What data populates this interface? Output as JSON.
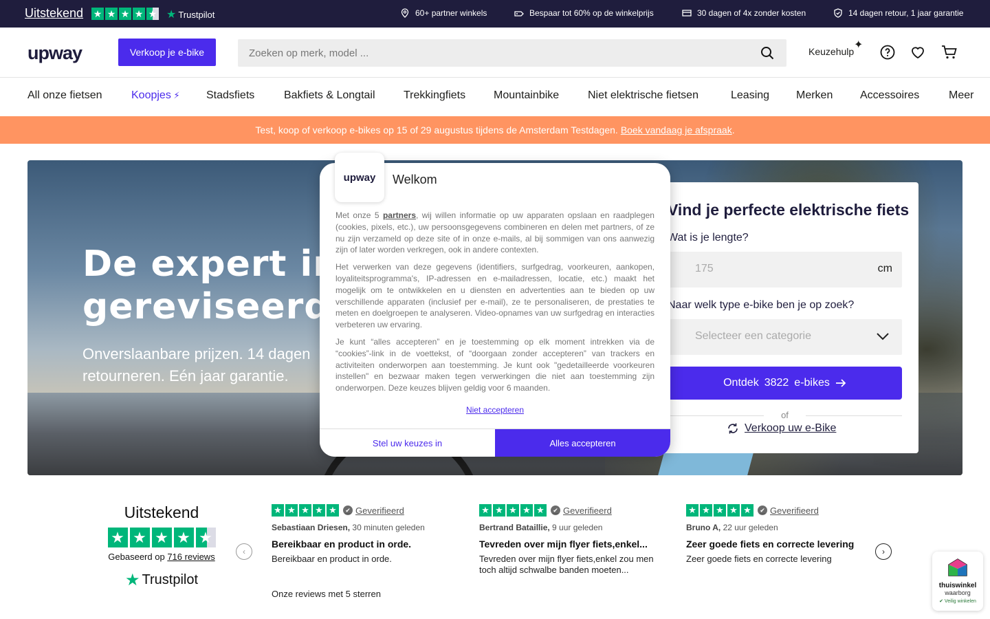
{
  "topbar": {
    "rating_label": "Uitstekend",
    "trustpilot": "Trustpilot",
    "usps": [
      {
        "icon": "pin-icon",
        "label": "60+ partner winkels"
      },
      {
        "icon": "tag-icon",
        "label": "Bespaar tot 60% op de winkelprijs"
      },
      {
        "icon": "card-icon",
        "label": "30 dagen of 4x zonder kosten"
      },
      {
        "icon": "shield-icon",
        "label": "14 dagen retour, 1 jaar garantie"
      }
    ]
  },
  "header": {
    "logo": "upway",
    "sell_button": "Verkoop je e-bike",
    "search_placeholder": "Zoeken op merk, model ...",
    "keuzehulp": "Keuzehulp"
  },
  "nav": {
    "items": [
      "All onze fietsen",
      "Koopjes",
      "Stadsfiets",
      "Bakfiets & Longtail",
      "Trekkingfiets",
      "Mountainbike",
      "Niet elektrische fietsen",
      "Leasing",
      "Merken",
      "Accessoires",
      "Meer"
    ]
  },
  "banner": {
    "text": "Test, koop of verkoop e-bikes op 15 of 29 augustus tijdens de Amsterdam Testdagen.",
    "link": "Boek vandaag je afspraak",
    "suffix": "."
  },
  "hero": {
    "title_line1": "De expert in",
    "title_line2": "gereviseerde e-bikes",
    "subtitle": "Onverslaanbare prijzen. 14 dagen retourneren. Eén jaar garantie."
  },
  "finder": {
    "title": "Vind je perfecte elektrische fiets",
    "height_label": "Wat is je lengte?",
    "height_placeholder": "175",
    "height_unit": "cm",
    "type_label": "Naar welk type e-bike ben je op zoek?",
    "type_placeholder": "Selecteer een categorie",
    "cta_prefix": "Ontdek",
    "cta_count": "3822",
    "cta_suffix": "e-bikes",
    "or": "of",
    "sell_link": "Verkoop uw e-Bike"
  },
  "consent": {
    "logo": "upway",
    "title": "Welkom",
    "p1_before": "Met onze 5",
    "p1_link": "partners",
    "p1_after": ", wij willen informatie op uw apparaten opslaan en raadplegen (cookies, pixels, etc.), uw persoonsgegevens combineren en delen met partners, of ze nu zijn verzameld op deze site of in onze e-mails, al bij sommigen van ons aanwezig zijn of later worden verkregen, ook in andere contexten.",
    "p2": "Het verwerken van deze gegevens (identifiers, surfgedrag, voorkeuren, aankopen, loyaliteitsprogramma's, IP-adressen en e-mailadressen, locatie, etc.) maakt het mogelijk om te ontwikkelen en u diensten en advertenties aan te bieden op uw verschillende apparaten (inclusief per e-mail), ze te personaliseren, de prestaties te meten en doelgroepen te analyseren. Video-opnames van uw surfgedrag en interacties verbeteren uw ervaring.",
    "p3": "Je kunt “alles accepteren” en je toestemming op elk moment intrekken via de “cookies”-link in de voettekst, of “doorgaan zonder accepteren” van trackers en activiteiten onderworpen aan toestemming. Je kunt ook \"gedetailleerde voorkeuren instellen\" en bezwaar maken tegen verwerkingen die niet aan toestemming zijn onderworpen. Deze keuzes blijven geldig voor 6 maanden.",
    "reject": "Niet accepteren",
    "configure": "Stel uw keuzes in",
    "accept_all": "Alles accepteren"
  },
  "reviews": {
    "summary_label": "Uitstekend",
    "based_prefix": "Gebaseerd op",
    "based_link": "716 reviews",
    "trustpilot": "Trustpilot",
    "verified": "Geverifieerd",
    "items": [
      {
        "author": "Sebastiaan Driesen,",
        "time": "30 minuten geleden",
        "title": "Bereikbaar en product in orde.",
        "text": "Bereikbaar en product in orde."
      },
      {
        "author": "Bertrand Bataillie,",
        "time": "9 uur geleden",
        "title": "Tevreden over mijn flyer fiets,enkel...",
        "text": "Tevreden over mijn flyer fiets,enkel zou men toch altijd schwalbe banden moeten..."
      },
      {
        "author": "Bruno A,",
        "time": "22 uur geleden",
        "title": "Zeer goede fiets en correcte levering",
        "text": "Zeer goede fiets en correcte levering"
      }
    ],
    "all_link": "Onze reviews met 5 sterren"
  },
  "badge": {
    "line1": "thuiswinkel",
    "line2": "waarborg",
    "line3": "✔ Veilig winkelen"
  },
  "colors": {
    "brand": "#4b2bec",
    "topbar": "#1f1d3d",
    "banner": "#ff9461",
    "trustpilot_green": "#00b67a"
  }
}
